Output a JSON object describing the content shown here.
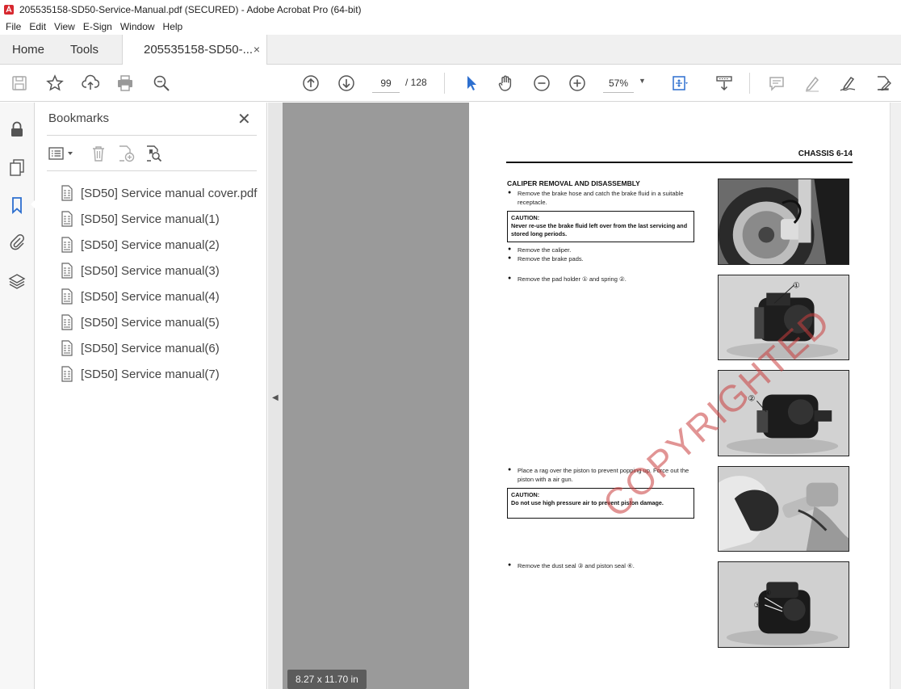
{
  "window": {
    "title": "205535158-SD50-Service-Manual.pdf (SECURED) - Adobe Acrobat Pro (64-bit)",
    "app_icon": "acrobat-icon"
  },
  "menubar": {
    "items": [
      "File",
      "Edit",
      "View",
      "E-Sign",
      "Window",
      "Help"
    ]
  },
  "tabs": {
    "home": "Home",
    "tools": "Tools",
    "doc": "205535158-SD50-...",
    "doc_close": "×"
  },
  "toolbar": {
    "page_current": "99",
    "page_total": "/  128",
    "zoom": "57%",
    "icons": [
      "save-icon",
      "star-icon",
      "upload-icon",
      "print-icon",
      "zoom-search-icon",
      "page-up-icon",
      "page-down-icon",
      "select-cursor-icon",
      "hand-icon",
      "zoom-out-icon",
      "zoom-in-icon",
      "fit-page-icon",
      "scroll-mode-icon",
      "comment-icon",
      "highlight-icon",
      "sign-icon",
      "edit-icon"
    ]
  },
  "leftrail": {
    "icons": [
      "lock-icon",
      "pages-icon",
      "bookmark-icon",
      "attachment-icon",
      "layers-icon"
    ]
  },
  "bookmarks": {
    "title": "Bookmarks",
    "close": "✕",
    "items": [
      "[SD50] Service manual cover.pdf",
      "[SD50] Service manual(1)",
      "[SD50] Service manual(2)",
      "[SD50] Service manual(3)",
      "[SD50] Service manual(4)",
      "[SD50] Service manual(5)",
      "[SD50] Service manual(6)",
      "[SD50] Service manual(7)"
    ]
  },
  "document": {
    "page_size": "8.27 x 11.70 in",
    "header": "CHASSIS  6-14",
    "section_title": "CALIPER REMOVAL AND DISASSEMBLY",
    "step1": "Remove the brake hose and catch the brake fluid in a suitable receptacle.",
    "caution1_label": "CAUTION:",
    "caution1_text": "Never re-use the brake fluid left over from the last servicing and stored long periods.",
    "step2": "Remove the caliper.",
    "step3": "Remove the brake pads.",
    "step4": "Remove the pad holder ① and spring ②.",
    "step5": "Place a rag over the piston to prevent popping up. Force out the piston with a air gun.",
    "caution2_label": "CAUTION:",
    "caution2_text": "Do not use high pressure air to prevent piston damage.",
    "step6": "Remove the dust seal ③ and piston seal ④.",
    "watermark": "COPYRIGHTED",
    "callouts": [
      "①",
      "②",
      "③",
      "④"
    ]
  }
}
